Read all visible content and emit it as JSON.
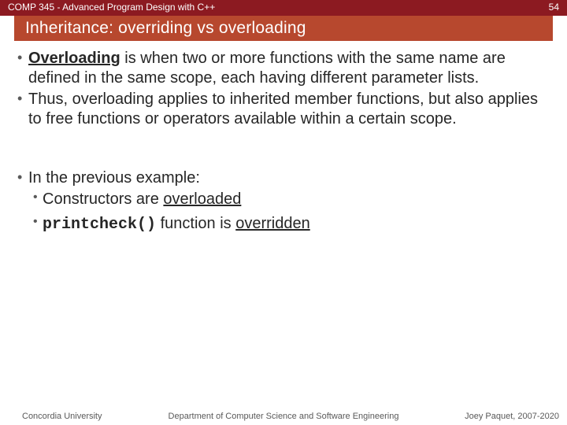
{
  "header": {
    "course": "COMP 345 - Advanced Program Design with C++",
    "slide_number": "54",
    "title": "Inheritance: overriding vs overloading"
  },
  "bullets": {
    "b1_strong": "Overloading",
    "b1_rest": " is when two or more functions with the same name are defined in the same scope, each having different parameter lists.",
    "b2": "Thus, overloading applies to inherited member functions, but also applies to free functions or operators available within a certain scope.",
    "b3": "In the previous example:",
    "b3a_pre": "Constructors are ",
    "b3a_u": "overloaded",
    "b3b_code": "printcheck()",
    "b3b_mid": " function is ",
    "b3b_u": "overridden"
  },
  "footer": {
    "left": "Concordia University",
    "mid": "Department of Computer Science and Software Engineering",
    "right": "Joey Paquet, 2007-2020"
  }
}
